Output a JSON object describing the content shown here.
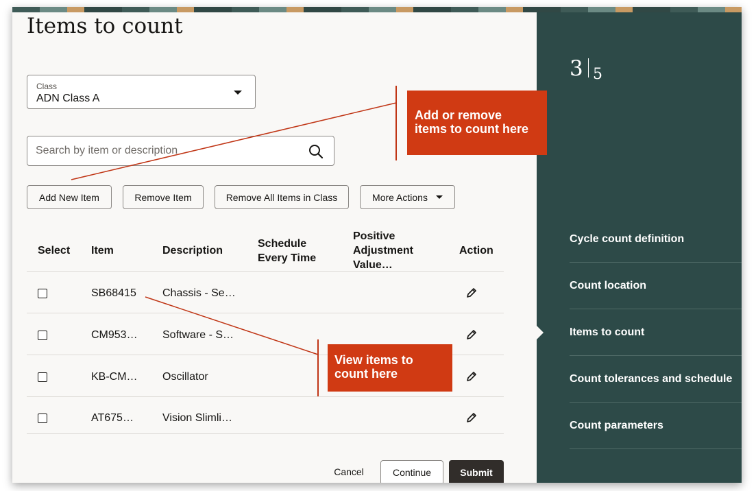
{
  "page": {
    "title": "Items to count"
  },
  "class_field": {
    "label": "Class",
    "value": "ADN Class A"
  },
  "search": {
    "placeholder": "Search by item or description"
  },
  "toolbar": {
    "add_new_item": "Add New Item",
    "remove_item": "Remove Item",
    "remove_all": "Remove All Items in Class",
    "more_actions": "More Actions"
  },
  "table": {
    "headers": {
      "select": "Select",
      "item": "Item",
      "description": "Description",
      "schedule_line1": "Schedule",
      "schedule_line2": "Every Time",
      "positive_line1": "Positive",
      "positive_line2": "Adjustment",
      "positive_line3": "Value…",
      "action": "Action"
    },
    "rows": [
      {
        "item": "SB68415",
        "description": "Chassis - Se…",
        "selected": false
      },
      {
        "item": "CM953…",
        "description": "Software - S…",
        "selected": false
      },
      {
        "item": "KB-CM…",
        "description": "Oscillator",
        "selected": false
      },
      {
        "item": "AT675…",
        "description": "Vision Slimli…",
        "selected": false
      }
    ]
  },
  "footer": {
    "cancel": "Cancel",
    "continue": "Continue",
    "submit": "Submit"
  },
  "stepper": {
    "current": "3",
    "total": "5",
    "steps": [
      "Cycle count definition",
      "Count location",
      "Items to count",
      "Count tolerances and schedule",
      "Count parameters"
    ],
    "active_step": "Items to count"
  },
  "callouts": {
    "add_remove_line1": "Add or remove",
    "add_remove_line2": "items to count here",
    "view_line1": "View items to",
    "view_line2": "count here"
  },
  "colors": {
    "sidebar_bg": "#2d4a48",
    "callout_bg": "#d03a13",
    "submit_bg": "#312d2a",
    "panel_bg": "#f9f8f6"
  }
}
